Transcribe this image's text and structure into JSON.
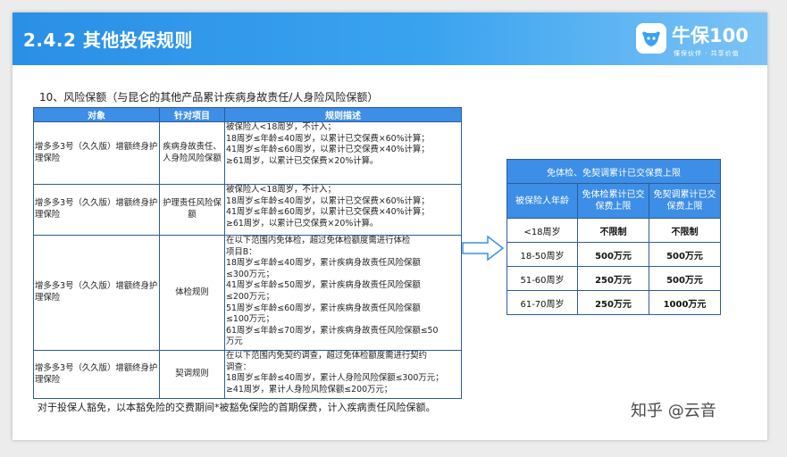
{
  "header": {
    "title": "2.4.2 其他投保规则",
    "logo_name": "牛保100",
    "logo_slogan": "懂保伙伴 · 共享价值"
  },
  "section_title": "10、风险保额（与昆仑的其他产品累计疾病身故责任/人身险风险保额）",
  "rule_table": {
    "headers": [
      "对象",
      "针对项目",
      "规则描述"
    ],
    "rows": [
      {
        "object": "增多多3号（久久版）增额终身护理保险",
        "item": "疾病身故责任、人身险风险保额",
        "desc": [
          "被保险人<18周岁，不计入；",
          "18周岁≤年龄≤40周岁，以累计已交保费×60%计算；",
          "41周岁≤年龄≤60周岁，以累计已交保费×40%计算；",
          "≥61周岁，以累计已交保费×20%计算。"
        ]
      },
      {
        "object": "增多多3号（久久版）增额终身护理保险",
        "item": "护理责任风险保额",
        "desc": [
          "被保险人<18周岁，不计入；",
          "18周岁≤年龄≤40周岁，以累计已交保费×60%计算；",
          "41周岁≤年龄≤60周岁，以累计已交保费×40%计算；",
          "≥61周岁，以累计已交保费×20%计算。"
        ]
      },
      {
        "object": "增多多3号（久久版）增额终身护理保险",
        "item": "体检规则",
        "desc": [
          "在以下范围内免体检，超过免体检额度需进行体检",
          "项目B：",
          "18周岁≤年龄≤40周岁，累计疾病身故责任风险保额",
          "≤300万元；",
          "41周岁≤年龄≤50周岁，累计疾病身故责任风险保额",
          "≤200万元；",
          "51周岁≤年龄≤60周岁，累计疾病身故责任风险保额",
          "≤100万元；",
          "61周岁≤年龄≤70周岁，累计疾病身故责任风险保额≤50",
          "万元"
        ]
      },
      {
        "object": "增多多3号（久久版）增额终身护理保险",
        "item": "契调规则",
        "desc": [
          "在以下范围内免契约调查，超过免体检额度需进行契约",
          "调查：",
          "18周岁≤年龄≤40周岁，累计人身险风险保额≤300万元；",
          "≥41周岁，累计人身险风险保额≤200万元；"
        ]
      }
    ]
  },
  "footnote": "对于投保人豁免，以本豁免险的交费期间*被豁免保险的首期保费，计入疾病责任风险保额。",
  "limit_table": {
    "title": "免体检、免契调累计已交保费上限",
    "col_headers": [
      "被保险人年龄",
      "免体检累计已交保费上限",
      "免契调累计已交保费上限"
    ],
    "rows": [
      [
        "<18周岁",
        "不限制",
        "不限制"
      ],
      [
        "18-50周岁",
        "500万元",
        "500万元"
      ],
      [
        "51-60周岁",
        "250万元",
        "500万元"
      ],
      [
        "61-70周岁",
        "250万元",
        "1000万元"
      ]
    ]
  },
  "watermark": "知乎 @云音",
  "colors": {
    "header_blue": "#2a8fe6",
    "table_header_blue": "#3d8ee6",
    "border_navy": "#2d5c97",
    "arrow_stroke": "#3d8ee6"
  }
}
